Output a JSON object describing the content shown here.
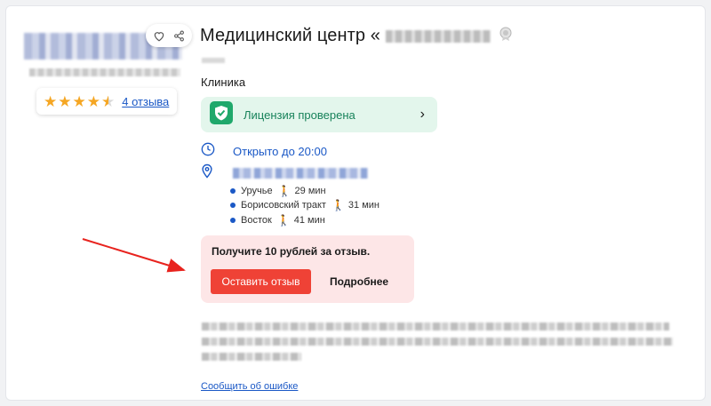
{
  "title": "Медицинский центр «",
  "category": "Клиника",
  "license": {
    "label": "Лицензия проверена"
  },
  "rating": {
    "stars": 4.5,
    "reviews_link": "4 отзыва"
  },
  "hours": "Открыто до 20:00",
  "metro": [
    {
      "station": "Уручье",
      "walk": "29 мин"
    },
    {
      "station": "Борисовский тракт",
      "walk": "31 мин"
    },
    {
      "station": "Восток",
      "walk": "41 мин"
    }
  ],
  "promo": {
    "title": "Получите 10 рублей за отзыв.",
    "button": "Оставить отзыв",
    "more": "Подробнее"
  },
  "report_error": "Сообщить об ошибке",
  "colors": {
    "accent_blue": "#1a58c6",
    "license_green": "#17825a",
    "promo_red": "#ef4236",
    "star": "#f5a623",
    "arrow": "#e8231e"
  }
}
